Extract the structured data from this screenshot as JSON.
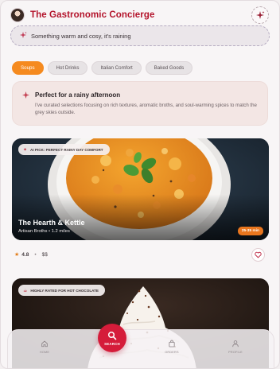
{
  "header": {
    "title": "The Gastronomic Concierge"
  },
  "search": {
    "value": "Something warm and cosy, it's raining"
  },
  "chips": [
    {
      "label": "Soups",
      "active": true
    },
    {
      "label": "Hot Drinks",
      "active": false
    },
    {
      "label": "Italian Comfort",
      "active": false
    },
    {
      "label": "Baked Goods",
      "active": false
    }
  ],
  "info": {
    "title": "Perfect for a rainy afternoon",
    "body": "I've curated selections focusing on rich textures, aromatic broths, and soul-warming spices to match the grey skies outside."
  },
  "cards": [
    {
      "badge": "AI PICK: PERFECT RAINY DAY COMFORT",
      "name": "The Hearth & Kettle",
      "subtitle": "Artisan Broths • 1.2 miles",
      "time": "25-35 min",
      "rating": "4.8",
      "price": "$$"
    },
    {
      "badge": "HIGHLY RATED FOR HOT CHOCOLATE"
    }
  ],
  "nav": {
    "home": "HOME",
    "search": "SEARCH",
    "orders": "ORDERS",
    "profile": "PROFILE"
  },
  "colors": {
    "brand": "#b3122a",
    "accent": "#f58a1f",
    "fab": "#d51c3a"
  }
}
